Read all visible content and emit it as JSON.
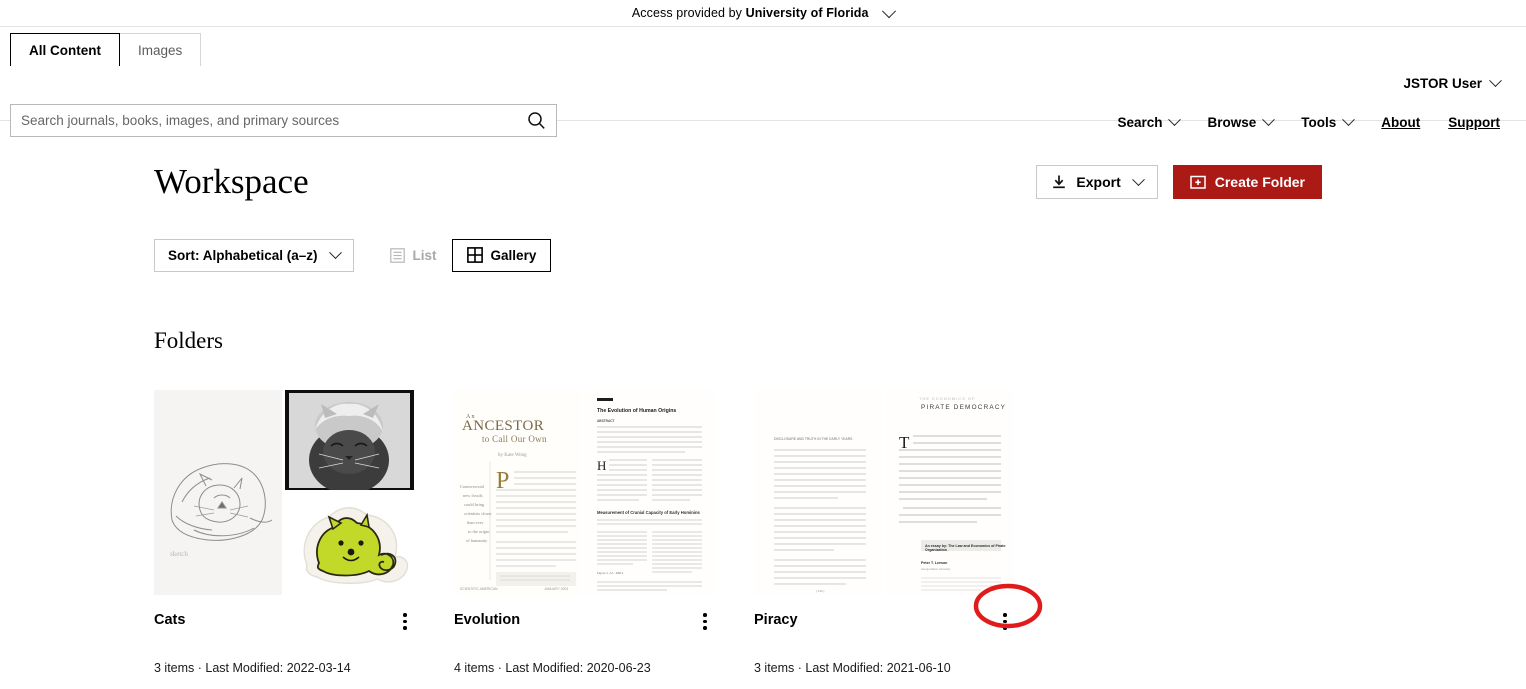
{
  "access_bar": {
    "prefix": "Access provided by ",
    "institution": "University of Florida",
    "chevron_icon": "chevron-down-icon"
  },
  "header": {
    "tabs": [
      {
        "label": "All Content",
        "active": true
      },
      {
        "label": "Images",
        "active": false
      }
    ],
    "search": {
      "placeholder": "Search journals, books, images, and primary sources",
      "value": "",
      "icon": "search-icon"
    },
    "user": {
      "label": "JSTOR User",
      "chevron_icon": "chevron-down-icon"
    },
    "nav": [
      {
        "label": "Search",
        "type": "dropdown",
        "icon": "chevron-down-icon"
      },
      {
        "label": "Browse",
        "type": "dropdown",
        "icon": "chevron-down-icon"
      },
      {
        "label": "Tools",
        "type": "dropdown",
        "icon": "chevron-down-icon"
      },
      {
        "label": "About",
        "type": "link"
      },
      {
        "label": "Support",
        "type": "link"
      }
    ]
  },
  "main": {
    "page_title": "Workspace",
    "export_button": {
      "label": "Export",
      "icon": "download-icon",
      "chevron_icon": "chevron-down-icon"
    },
    "create_folder_button": {
      "label": "Create Folder",
      "icon": "new-folder-icon",
      "color": "#AC1A16"
    },
    "sort": {
      "label": "Sort: Alphabetical (a–z)",
      "chevron_icon": "chevron-down-icon"
    },
    "view_toggle": [
      {
        "label": "List",
        "icon": "list-view-icon",
        "active": false
      },
      {
        "label": "Gallery",
        "icon": "gallery-view-icon",
        "active": true
      }
    ],
    "folders_heading": "Folders",
    "folders": [
      {
        "name": "Cats",
        "item_count": "3 items",
        "separator": " · ",
        "last_modified": "Last Modified: 2022-03-14",
        "menu_icon": "kebab-menu-icon",
        "thumbnail_kind": "images"
      },
      {
        "name": "Evolution",
        "item_count": "4 items",
        "separator": " · ",
        "last_modified": "Last Modified: 2020-06-23",
        "menu_icon": "kebab-menu-icon",
        "thumbnail_kind": "articles",
        "page_titles": [
          "An ANCESTOR to Call Our Own",
          "The Evolution of Human Origins"
        ]
      },
      {
        "name": "Piracy",
        "item_count": "3 items",
        "separator": " · ",
        "last_modified": "Last Modified: 2021-06-10",
        "menu_icon": "kebab-menu-icon",
        "thumbnail_kind": "articles",
        "page_titles": [
          "THE ECONOMICS OF PIRATE DEMOCRACY"
        ]
      }
    ]
  },
  "annotation": {
    "shape": "ellipse",
    "color": "#E01B1B",
    "target": "kebab-menu-icon of Piracy folder"
  }
}
